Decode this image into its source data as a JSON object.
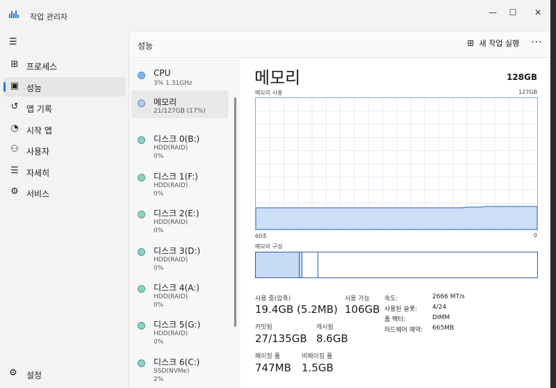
{
  "window": {
    "title": "작업 관리자",
    "minimize": "—",
    "maximize": "☐",
    "close": "✕"
  },
  "sidebar": {
    "menu_icon": "☰",
    "items": [
      {
        "label": "프로세스",
        "icon": "processes-icon",
        "glyph": "⊞",
        "active": false
      },
      {
        "label": "성능",
        "icon": "performance-icon",
        "glyph": "▣",
        "active": true
      },
      {
        "label": "앱 기록",
        "icon": "history-icon",
        "glyph": "↺",
        "active": false
      },
      {
        "label": "시작 앱",
        "icon": "startup-icon",
        "glyph": "◔",
        "active": false
      },
      {
        "label": "사용자",
        "icon": "users-icon",
        "glyph": "⚇",
        "active": false
      },
      {
        "label": "자세히",
        "icon": "details-icon",
        "glyph": "☰",
        "active": false
      },
      {
        "label": "서비스",
        "icon": "services-icon",
        "glyph": "⚙",
        "active": false
      }
    ],
    "settings_label": "설정",
    "settings_glyph": "⚙"
  },
  "header": {
    "title": "성능",
    "new_task_label": "새 작업 실행",
    "new_task_glyph": "⊞",
    "more_glyph": "···"
  },
  "devices": [
    {
      "name": "CPU",
      "sub1": "3%  1.31GHz",
      "sub2": "",
      "dot_color": "#7fb6e8",
      "active": false
    },
    {
      "name": "메모리",
      "sub1": "21/127GB (17%)",
      "sub2": "",
      "dot_color": "#b9c3ee",
      "active": true
    },
    {
      "name": "디스크 0(B:)",
      "sub1": "HDD(RAID)",
      "sub2": "0%",
      "dot_color": "#8fd0c4",
      "active": false
    },
    {
      "name": "디스크 1(F:)",
      "sub1": "HDD(RAID)",
      "sub2": "0%",
      "dot_color": "#8fd0c4",
      "active": false
    },
    {
      "name": "디스크 2(E:)",
      "sub1": "HDD(RAID)",
      "sub2": "0%",
      "dot_color": "#8fd0c4",
      "active": false
    },
    {
      "name": "디스크 3(D:)",
      "sub1": "HDD(RAID)",
      "sub2": "0%",
      "dot_color": "#8fd0c4",
      "active": false
    },
    {
      "name": "디스크 4(A:)",
      "sub1": "HDD(RAID)",
      "sub2": "0%",
      "dot_color": "#8fd0c4",
      "active": false
    },
    {
      "name": "디스크 5(G:)",
      "sub1": "HDD(RAID)",
      "sub2": "0%",
      "dot_color": "#8fd0c4",
      "active": false
    },
    {
      "name": "디스크 6(C:)",
      "sub1": "SSD(NVMe)",
      "sub2": "2%",
      "dot_color": "#8fd0c4",
      "active": false
    }
  ],
  "memory": {
    "title": "메모리",
    "total": "128GB",
    "usage_label": "메모리 사용",
    "usage_max": "127GB",
    "time_left": "60초",
    "time_right": "0",
    "composition_label": "메모리 구성",
    "usage_fraction": 0.17,
    "stats": {
      "in_use_label": "사용 중(압축)",
      "in_use_value": "19.4GB (5.2MB)",
      "available_label": "사용 가능",
      "available_value": "106GB",
      "committed_label": "커밋됨",
      "committed_value": "27/135GB",
      "cached_label": "캐시됨",
      "cached_value": "8.6GB",
      "paged_label": "페이징 풀",
      "paged_value": "747MB",
      "nonpaged_label": "비페이징 풀",
      "nonpaged_value": "1.5GB"
    },
    "specs": {
      "speed_label": "속도:",
      "speed_value": "2666 MT/s",
      "slots_label": "사용된 슬롯:",
      "slots_value": "4/24",
      "form_label": "폼 팩터:",
      "form_value": "DIMM",
      "reserved_label": "하드웨어 예약:",
      "reserved_value": "665MB"
    }
  },
  "colors": {
    "accent": "#2b78d6",
    "graph_fill": "#c6dcf5",
    "graph_line": "#2a5db0",
    "grid": "#e4ecf5"
  }
}
